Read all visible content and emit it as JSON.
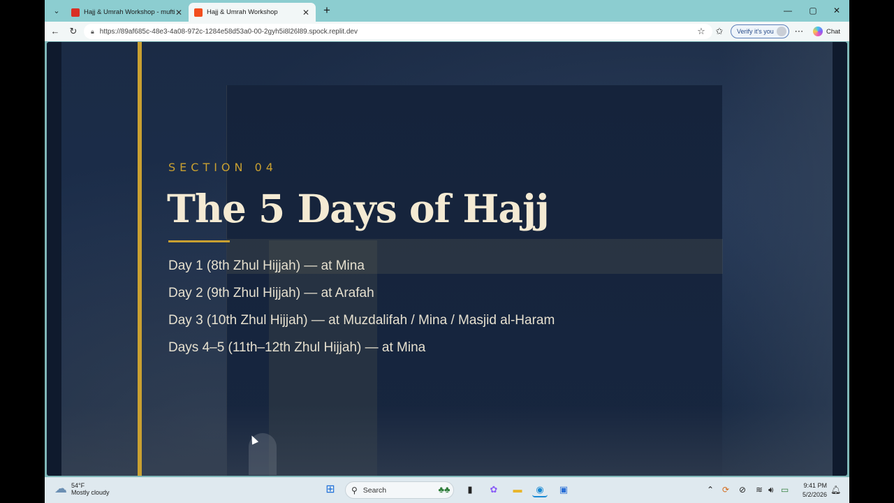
{
  "browser": {
    "tabs": [
      {
        "title": "Hajj & Umrah Workshop - muftisa",
        "favicon_color": "#d93025",
        "active": false
      },
      {
        "title": "Hajj & Umrah Workshop",
        "favicon_color": "#f24e1e",
        "active": true
      }
    ],
    "url": "https://89af685c-48e3-4a08-972c-1284e58d53a0-00-2gyh5i8l26l89.spock.replit.dev",
    "verify_label": "Verify it's you",
    "chat_label": "Chat",
    "icons": {
      "tab_menu": "chevron-down-icon",
      "new_tab": "plus-icon",
      "back": "back-arrow-icon",
      "reload": "reload-icon",
      "lock": "lock-icon",
      "favorite": "star-icon",
      "favorites": "favorites-icon",
      "more": "more-icon",
      "minimize": "minimize-icon",
      "maximize": "maximize-icon",
      "close": "close-icon"
    }
  },
  "slide": {
    "section": "SECTION 04",
    "title": "The 5 Days of Hajj",
    "accent_color": "#c9a031",
    "days": [
      "Day 1 (8th Zhul Hijjah) — at Mina",
      "Day 2 (9th Zhul Hijjah) — at Arafah",
      "Day 3 (10th Zhul Hijjah) — at Muzdalifah / Mina / Masjid al-Haram",
      "Days 4–5 (11th–12th Zhul Hijjah) — at Mina"
    ]
  },
  "taskbar": {
    "weather_temp": "54°F",
    "weather_desc": "Mostly cloudy",
    "search_label": "Search",
    "time": "9:41 PM",
    "date": "5/2/2026"
  }
}
